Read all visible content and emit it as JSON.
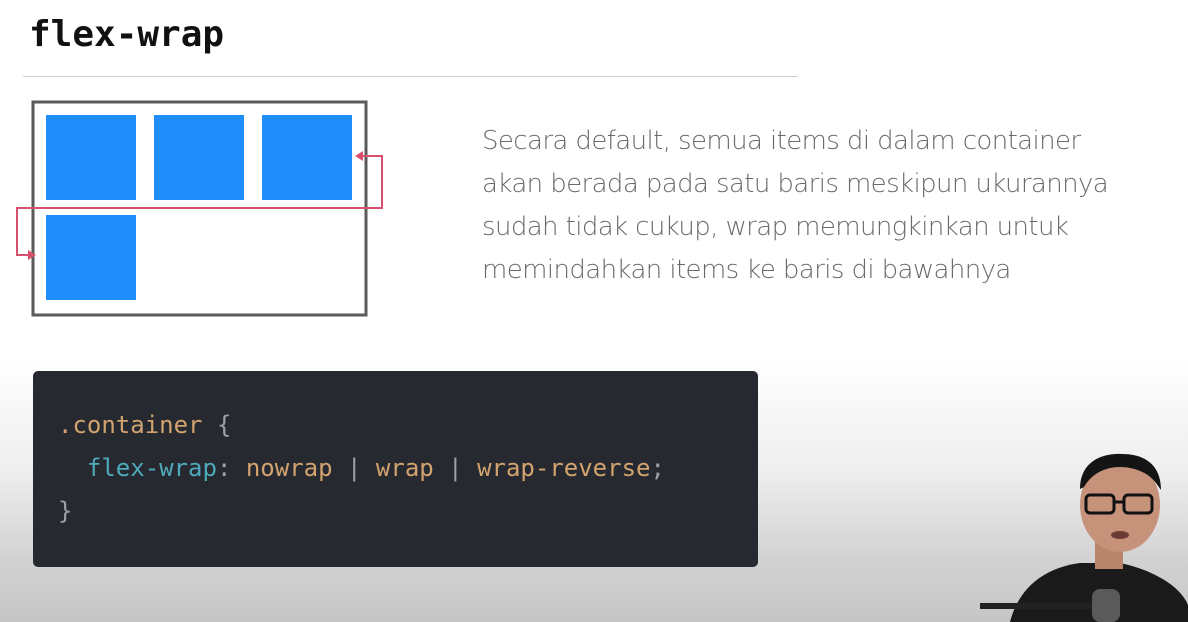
{
  "slide": {
    "title": "flex-wrap",
    "description_lines": [
      "Secara default, semua items di dalam container",
      "akan berada pada satu baris meskipun ukurannya",
      "sudah tidak cukup, wrap memungkinkan untuk",
      "memindahkan items ke baris di bawahnya"
    ]
  },
  "code": {
    "selector": ".container",
    "open_brace": "{",
    "property": "flex-wrap",
    "colon": ":",
    "values": [
      "nowrap",
      "wrap",
      "wrap-reverse"
    ],
    "separator": "|",
    "semicolon": ";",
    "close_brace": "}"
  },
  "colors": {
    "item_blue": "#1f8efa",
    "arrow_red": "#d9506e",
    "container_border": "#5a5a5a",
    "code_bg": "#272931"
  },
  "icons": {
    "presenter": "presenter-webcam-overlay"
  }
}
